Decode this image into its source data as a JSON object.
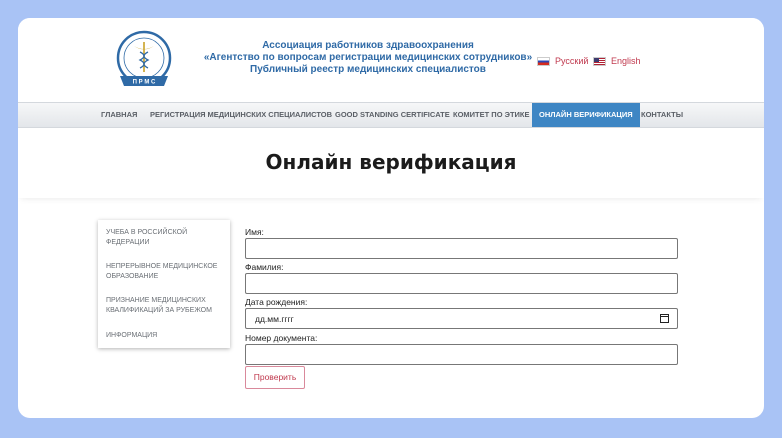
{
  "header": {
    "logo_text": "П Р М С",
    "org_lines": [
      "Ассоциация работников здравоохранения",
      "«Агентство по вопросам регистрации медицинских сотрудников»",
      "Публичный реестр медицинских специалистов"
    ],
    "languages": [
      {
        "label": "Русский",
        "icon": "flag-ru-icon"
      },
      {
        "label": "English",
        "icon": "flag-us-icon"
      }
    ]
  },
  "nav": {
    "items": [
      {
        "label": "ГЛАВНАЯ"
      },
      {
        "label": "РЕГИСТРАЦИЯ МЕДИЦИНСКИХ СПЕЦИАЛИСТОВ"
      },
      {
        "label": "GOOD STANDING CERTIFICATE"
      },
      {
        "label": "КОМИТЕТ ПО ЭТИКЕ"
      },
      {
        "label": "ОНЛАЙН ВЕРИФИКАЦИЯ"
      },
      {
        "label": "КОНТАКТЫ"
      }
    ],
    "active": "ОНЛАЙН ВЕРИФИКАЦИЯ"
  },
  "page_title": "Онлайн верификация",
  "sidemenu": {
    "items": [
      {
        "label": "УЧЕБА В РОССИЙСКОЙ ФЕДЕРАЦИИ"
      },
      {
        "label": "НЕПРЕРЫВНОЕ МЕДИЦИНСКОЕ ОБРАЗОВАНИЕ"
      },
      {
        "label": "ПРИЗНАНИЕ МЕДИЦИНСКИХ КВАЛИФИКАЦИЙ ЗА РУБЕЖОМ"
      },
      {
        "label": "ИНФОРМАЦИЯ"
      }
    ]
  },
  "form": {
    "name_label": "Имя:",
    "name_value": "",
    "surname_label": "Фамилия:",
    "surname_value": "",
    "dob_label": "Дата рождения:",
    "dob_value": "дд.мм.гггг",
    "doc_label": "Номер документа:",
    "doc_value": "",
    "submit_label": "Проверить"
  },
  "colors": {
    "page_background": "#a9c3f5",
    "brand_blue": "#2f6aa6",
    "nav_active": "#3e86c4",
    "accent_red": "#c0394e"
  }
}
